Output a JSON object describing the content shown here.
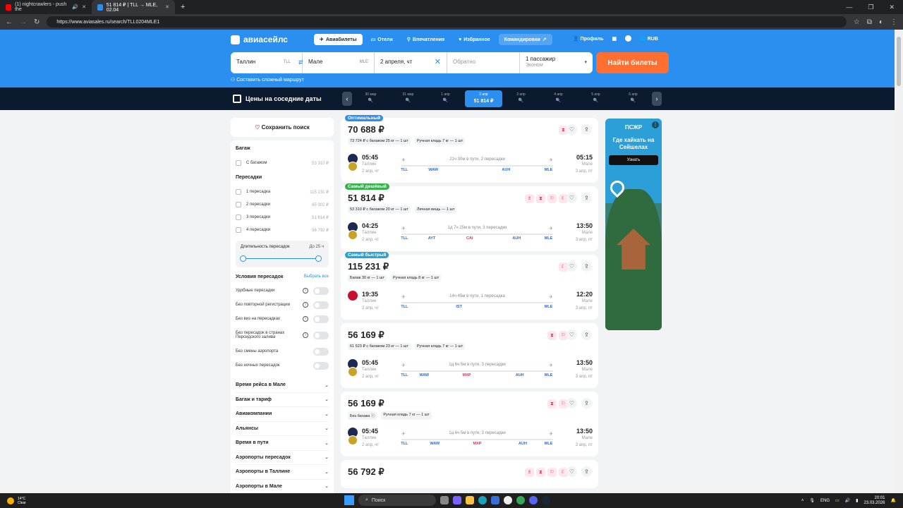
{
  "browser": {
    "tabs": [
      {
        "title": "(1) nightcrawlers - push the",
        "favicon_color": "#ff0000"
      },
      {
        "title": "51 814 ₽ | TLL → MLE, 02.04",
        "favicon_color": "#2b8ff0"
      }
    ],
    "url": "https://www.aviasales.ru/search/TLL0204MLE1"
  },
  "header": {
    "logo": "авиасейлс",
    "nav": [
      {
        "label": "Авиабилеты",
        "icon": "plane-icon"
      },
      {
        "label": "Отели",
        "icon": "bed-icon"
      },
      {
        "label": "Впечатления",
        "icon": "pin-icon"
      },
      {
        "label": "Избранное",
        "icon": "heart-icon"
      },
      {
        "label": "Командировки",
        "icon": "external-icon"
      }
    ],
    "profile": "Профиль",
    "currency": "RUB"
  },
  "search": {
    "from": "Таллин",
    "from_code": "TLL",
    "to": "Мале",
    "to_code": "MLE",
    "date": "2 апреля, чт",
    "return_placeholder": "Обратно",
    "passengers": "1 пассажир",
    "class": "Эконом",
    "button": "Найти билеты",
    "complex_route": "Составить сложный маршрут"
  },
  "dates": {
    "title": "Цены на соседние даты",
    "items": [
      {
        "label": "30 мар",
        "value": "🔍"
      },
      {
        "label": "31 мар",
        "value": "🔍"
      },
      {
        "label": "1 апр",
        "value": "🔍"
      },
      {
        "label": "2 апр",
        "value": "51 814 ₽"
      },
      {
        "label": "3 апр",
        "value": "🔍"
      },
      {
        "label": "4 апр",
        "value": "🔍"
      },
      {
        "label": "5 апр",
        "value": "🔍"
      },
      {
        "label": "6 апр",
        "value": "🔍"
      }
    ]
  },
  "filters": {
    "save": "Сохранить поиск",
    "baggage_title": "Багаж",
    "baggage": [
      {
        "label": "С багажом",
        "price": "53 310 ₽"
      }
    ],
    "stops_title": "Пересадки",
    "stops": [
      {
        "label": "1 пересадка",
        "price": "115 231 ₽"
      },
      {
        "label": "2 пересадки",
        "price": "65 302 ₽"
      },
      {
        "label": "3 пересадки",
        "price": "51 814 ₽"
      },
      {
        "label": "4 пересадки",
        "price": "56 792 ₽"
      }
    ],
    "duration_label": "Длительность пересадок",
    "duration_value": "До 25 ч",
    "conditions_title": "Условия пересадок",
    "select_all": "Выбрать все",
    "conditions": [
      {
        "label": "Удобные пересадки",
        "info": true
      },
      {
        "label": "Без повторной регистрации",
        "info": true
      },
      {
        "label": "Без виз на пересадках",
        "info": true
      },
      {
        "label": "Без пересадок в странах Персидского залива",
        "info": true
      },
      {
        "label": "Без смены аэропорта",
        "info": false
      },
      {
        "label": "Без ночных пересадок",
        "info": false
      }
    ],
    "accordions": [
      "Время рейса в Мале",
      "Багаж и тариф",
      "Авиакомпании",
      "Альянсы",
      "Время в пути",
      "Аэропорты пересадок",
      "Аэропорты в Таллине",
      "Аэропорты в Мале"
    ]
  },
  "results": [
    {
      "badge": "Оптимальный",
      "badge_type": "opt",
      "price": "70 688 ₽",
      "bags": [
        "73 724 ₽ с багажом 25 кг — 1 шт",
        "Ручная кладь 7 кг — 1 шт"
      ],
      "tags": [
        "⧗"
      ],
      "airline": "lot",
      "dep_time": "05:45",
      "dep_city": "Таллин",
      "dep_date": "2 апр, чт",
      "arr_time": "05:15",
      "arr_city": "Мале",
      "arr_date": "3 апр, пт",
      "duration": "21ч 30м в пути, 2 пересадки",
      "codes": [
        {
          "c": "TLL",
          "p": 2,
          "red": false
        },
        {
          "c": "WAW",
          "p": 21,
          "red": false
        },
        {
          "c": "AUH",
          "p": 69,
          "red": false
        },
        {
          "c": "MLE",
          "p": 97,
          "red": false
        }
      ]
    },
    {
      "badge": "Самый дешёвый",
      "badge_type": "cheap",
      "price": "51 814 ₽",
      "bags": [
        "53 310 ₽ с багажом 20 кг — 1 шт",
        "Личная вещь — 1 шт"
      ],
      "tags": [
        "♗",
        "⧗",
        "⚐",
        "☾"
      ],
      "airline": "lot",
      "dep_time": "04:25",
      "dep_city": "Таллин",
      "dep_date": "2 апр, чт",
      "arr_time": "13:50",
      "arr_city": "Мале",
      "arr_date": "3 апр, пт",
      "duration": "1д 7ч 25м в пути, 3 пересадки",
      "codes": [
        {
          "c": "TLL",
          "p": 2,
          "red": false
        },
        {
          "c": "AYT",
          "p": 20,
          "red": false
        },
        {
          "c": "CAI",
          "p": 45,
          "red": true
        },
        {
          "c": "AUH",
          "p": 76,
          "red": false
        },
        {
          "c": "MLE",
          "p": 97,
          "red": false
        }
      ]
    },
    {
      "badge": "Самый быстрый",
      "badge_type": "fast",
      "price": "115 231 ₽",
      "bags": [
        "Багаж 30 кг — 1 шт",
        "Ручная кладь 8 кг — 1 шт"
      ],
      "tags": [
        "☾"
      ],
      "airline": "tk",
      "dep_time": "19:35",
      "dep_city": "Таллин",
      "dep_date": "2 апр, чт",
      "arr_time": "12:20",
      "arr_city": "Мале",
      "arr_date": "3 апр, пт",
      "duration": "14ч 45м в пути, 1 пересадка",
      "codes": [
        {
          "c": "TLL",
          "p": 2,
          "red": false
        },
        {
          "c": "IST",
          "p": 38,
          "red": false
        },
        {
          "c": "MLE",
          "p": 97,
          "red": false
        }
      ]
    },
    {
      "badge": "",
      "badge_type": "",
      "price": "56 169 ₽",
      "bags": [
        "61 523 ₽ с багажом 23 кг — 1 шт",
        "Ручная кладь 7 кг — 1 шт"
      ],
      "tags": [
        "⧗",
        "⚐"
      ],
      "airline": "lot",
      "dep_time": "05:45",
      "dep_city": "Таллин",
      "dep_date": "2 апр, чт",
      "arr_time": "13:50",
      "arr_city": "Мале",
      "arr_date": "3 апр, пт",
      "duration": "1д 6ч 5м в пути, 3 пересадки",
      "codes": [
        {
          "c": "TLL",
          "p": 2,
          "red": false
        },
        {
          "c": "WAW",
          "p": 15,
          "red": false
        },
        {
          "c": "MXP",
          "p": 43,
          "red": true
        },
        {
          "c": "AUH",
          "p": 78,
          "red": false
        },
        {
          "c": "MLE",
          "p": 97,
          "red": false
        }
      ]
    },
    {
      "badge": "",
      "badge_type": "",
      "price": "56 169 ₽",
      "bags": [
        "Без багажа ⓘ",
        "Ручная кладь 7 кг — 1 шт"
      ],
      "tags": [
        "⧗",
        "⚐"
      ],
      "airline": "lot",
      "dep_time": "05:45",
      "dep_city": "Таллин",
      "dep_date": "2 апр, чт",
      "arr_time": "13:50",
      "arr_city": "Мале",
      "arr_date": "3 апр, пт",
      "duration": "1д 6ч 5м в пути, 3 пересадки",
      "codes": [
        {
          "c": "TLL",
          "p": 2,
          "red": false
        },
        {
          "c": "WAW",
          "p": 22,
          "red": false
        },
        {
          "c": "MXP",
          "p": 50,
          "red": true
        },
        {
          "c": "AUH",
          "p": 80,
          "red": false
        },
        {
          "c": "MLE",
          "p": 97,
          "red": false
        }
      ]
    },
    {
      "badge": "",
      "badge_type": "",
      "price": "56 792 ₽",
      "bags": [],
      "tags": [
        "♗",
        "⧗",
        "⚐",
        "☾"
      ],
      "airline": "lot",
      "dep_time": "",
      "dep_city": "",
      "dep_date": "",
      "arr_time": "",
      "arr_city": "",
      "arr_date": "",
      "duration": "",
      "codes": []
    }
  ],
  "ad": {
    "logo": "ПСЖР",
    "title": "Где хайкать на Сейшелах",
    "button": "Узнать"
  },
  "taskbar": {
    "temp": "14°C",
    "weather": "Clear",
    "search": "Поиск",
    "lang": "ENG",
    "time": "20:01",
    "date": "23.03.2026"
  }
}
